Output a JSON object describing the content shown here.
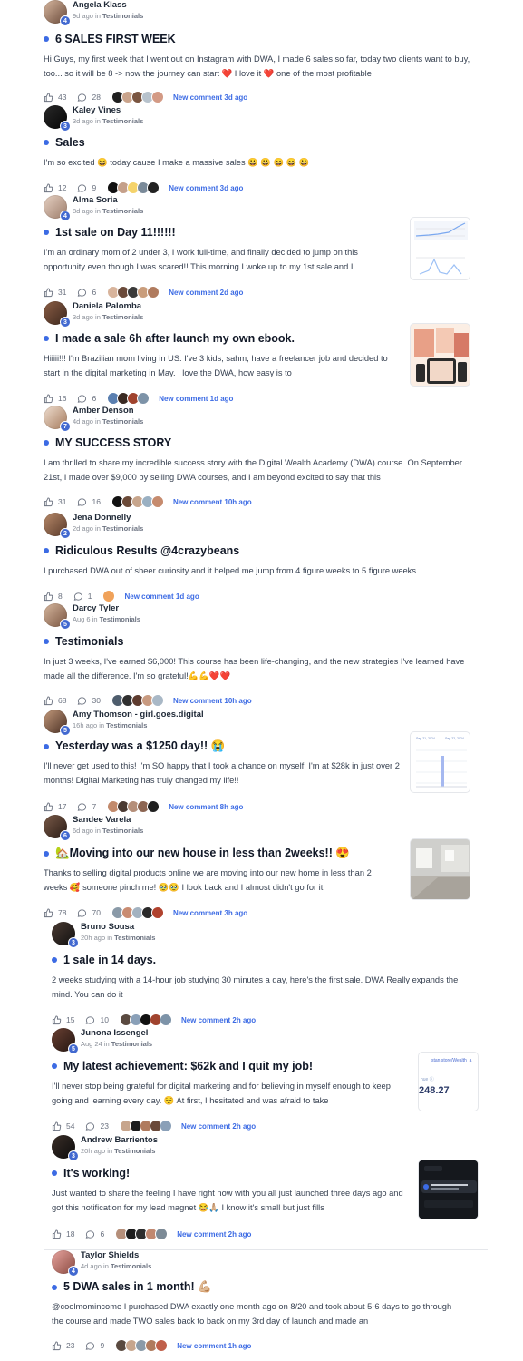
{
  "colors": {
    "accent": "#3c6be4",
    "heart": "#e11d48"
  },
  "posts": [
    {
      "author": "Angela Klass",
      "level": "4",
      "time": "9d ago in",
      "space": "Testimonials",
      "title": "6 SALES FIRST WEEK",
      "excerpt": "Hi Guys, my first week that I went out on Instagram with DWA, I made 6 sales so far, today two clients want to buy, too... so it will be 8 -> now the journey can start ❤️ I love it ❤️ one of the most profitable",
      "likes": "43",
      "comments": "28",
      "new_comment": "New comment 3d ago"
    },
    {
      "author": "Kaley Vines",
      "level": "3",
      "time": "3d ago in",
      "space": "Testimonials",
      "title": "Sales",
      "excerpt": "I'm so excited 😆 today cause I make a massive sales 😃 😃 😄 😄 😃",
      "likes": "12",
      "comments": "9",
      "new_comment": "New comment 3d ago"
    },
    {
      "author": "Alma Soria",
      "level": "4",
      "time": "8d ago in",
      "space": "Testimonials",
      "title": "1st sale on Day 11!!!!!!",
      "excerpt": "I'm an ordinary mom of 2 under 3, I work full-time, and finally decided to jump on this opportunity even though I was scared!! This morning I woke up to my 1st sale and I",
      "likes": "31",
      "comments": "6",
      "new_comment": "New comment 2d ago"
    },
    {
      "author": "Daniela Palomba",
      "level": "3",
      "time": "3d ago in",
      "space": "Testimonials",
      "title": "I made a sale 6h after launch my own ebook.",
      "excerpt": "Hiiiii!!! I'm Brazilian mom living in US. I've 3 kids, sahm, have a freelancer job and decided to start in the digital marketing in May. I love the DWA, how easy is to",
      "likes": "16",
      "comments": "6",
      "new_comment": "New comment 1d ago"
    },
    {
      "author": "Amber Denson",
      "level": "7",
      "time": "4d ago in",
      "space": "Testimonials",
      "title": "MY SUCCESS STORY",
      "excerpt": "I am thrilled to share my incredible success story with the Digital Wealth Academy (DWA) course. On September 21st, I made over $9,000 by selling DWA courses, and I am beyond excited to say that this",
      "likes": "31",
      "comments": "16",
      "new_comment": "New comment 10h ago"
    },
    {
      "author": "Jena Donnelly",
      "level": "2",
      "time": "2d ago in",
      "space": "Testimonials",
      "title": "Ridiculous Results @4crazybeans",
      "excerpt": "I purchased DWA out of sheer curiosity and it helped me jump from 4 figure weeks to 5 figure weeks.",
      "likes": "8",
      "comments": "1",
      "new_comment": "New comment 1d ago"
    },
    {
      "author": "Darcy Tyler",
      "level": "5",
      "time": "Aug 6 in",
      "space": "Testimonials",
      "title": "Testimonials",
      "excerpt": "In just 3 weeks, I've earned $6,000! This course has been life-changing, and the new strategies I've learned have made all the difference. I'm so grateful!💪💪❤️❤️",
      "likes": "68",
      "comments": "30",
      "new_comment": "New comment 10h ago"
    },
    {
      "author": "Amy Thomson - girl.goes.digital",
      "level": "5",
      "time": "16h ago in",
      "space": "Testimonials",
      "title": "Yesterday was a $1250 day!! 😭",
      "excerpt": "I'll never get used to this! I'm SO happy that I took a chance on myself. I'm at $28k in just over 2 months! Digital Marketing has truly changed my life!!",
      "likes": "17",
      "comments": "7",
      "new_comment": "New comment 8h ago"
    },
    {
      "author": "Sandee Varela",
      "level": "6",
      "time": "6d ago in",
      "space": "Testimonials",
      "title": "🏡Moving into our new house in less than 2weeks!! 😍",
      "excerpt": "Thanks to selling digital products online we are moving into our new home in less than 2 weeks 🥰 someone pinch me! 🥹🥹 I look back and I almost didn't go for it",
      "likes": "78",
      "comments": "70",
      "new_comment": "New comment 3h ago"
    },
    {
      "author": "Bruno Sousa",
      "level": "3",
      "time": "20h ago in",
      "space": "Testimonials",
      "title": "1 sale in 14 days.",
      "excerpt": "2 weeks studying with a 14-hour job studying 30 minutes a day, here's the first sale. DWA Really expands the mind. You can do it",
      "likes": "15",
      "comments": "10",
      "new_comment": "New comment 2h ago"
    },
    {
      "author": "Junona Issengel",
      "level": "5",
      "time": "Aug 24 in",
      "space": "Testimonials",
      "title": "My latest achievement: $62k and I quit my job!",
      "excerpt": "I'll never stop being grateful for digital marketing and for believing in myself enough to keep going and learning every day. 😌 At first, I hesitated and was afraid to take",
      "likes": "54",
      "comments": "23",
      "new_comment": "New comment 2h ago"
    },
    {
      "author": "Andrew Barrientos",
      "level": "3",
      "time": "20h ago in",
      "space": "Testimonials",
      "title": "It's working!",
      "excerpt": "Just wanted to share the feeling I have right now with you all just launched three days ago and got this notification for my lead magnet 😂🙏🏼 I know it's small but just fills",
      "likes": "18",
      "comments": "6",
      "new_comment": "New comment 2h ago"
    },
    {
      "author": "Taylor Shields",
      "level": "4",
      "time": "4d ago in",
      "space": "Testimonials",
      "title": "5 DWA sales in 1 month! 💪🏼",
      "excerpt": "@coolmomincome I purchased DWA exactly one month ago on 8/20 and took about 5-6 days to go through the course and made TWO sales back to back on my 3rd day of launch and made an",
      "likes": "23",
      "comments": "9",
      "new_comment": "New comment 1h ago"
    }
  ],
  "thumbs": {
    "alma": {
      "label": "analytics-chart"
    },
    "daniela": {
      "label": "ebook-mockup"
    },
    "amy": {
      "labels": [
        "Sep 21, 2024",
        "Sep 22, 2024"
      ]
    },
    "sandee": {
      "label": "house-photo"
    },
    "junona": {
      "url_text": "stan.store/Wealth_a",
      "amount": "248.27",
      "prefix": "hue ⓘ"
    },
    "andrew": {
      "label": "phone-notification"
    }
  }
}
